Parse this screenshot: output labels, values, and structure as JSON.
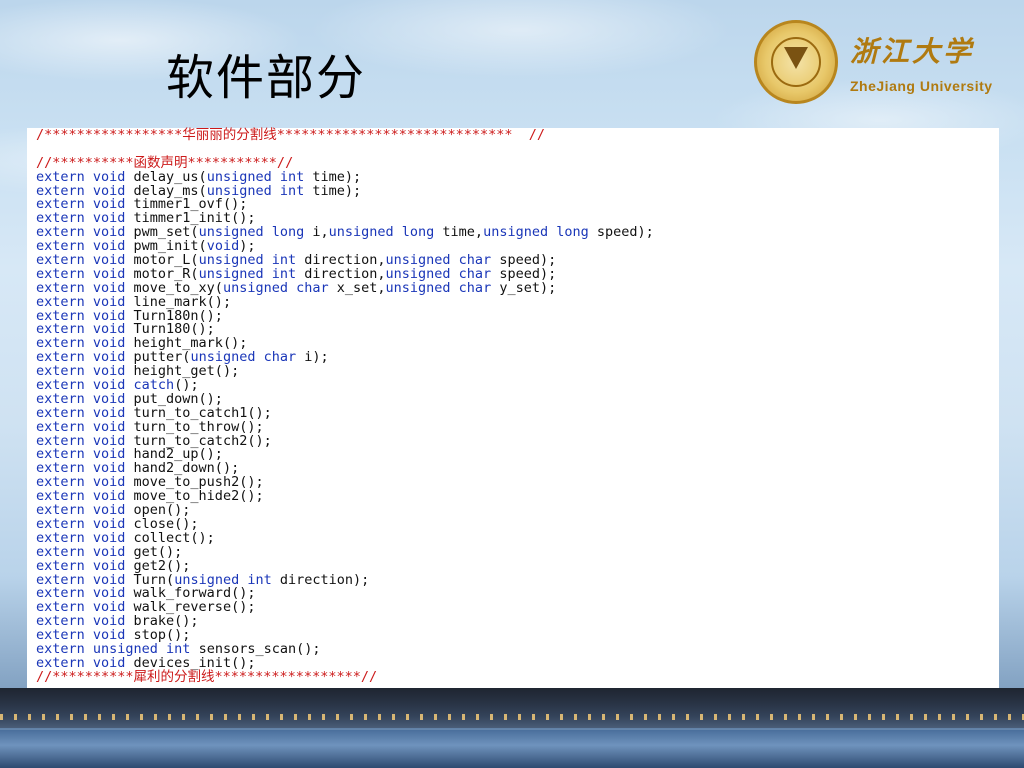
{
  "slide": {
    "title": "软件部分"
  },
  "logo": {
    "name_cn": "浙江大学",
    "name_en": "ZheJiang University"
  },
  "code_lines": [
    [
      [
        "/*****************华丽丽的分割线*****************************  //",
        "comment"
      ]
    ],
    [
      [
        "",
        "plain"
      ]
    ],
    [
      [
        "//**********函数声明***********//",
        "comment"
      ]
    ],
    [
      [
        "extern void",
        "kw"
      ],
      [
        " delay_us(",
        "plain"
      ],
      [
        "unsigned int",
        "kw"
      ],
      [
        " time);",
        "plain"
      ]
    ],
    [
      [
        "extern void",
        "kw"
      ],
      [
        " delay_ms(",
        "plain"
      ],
      [
        "unsigned int",
        "kw"
      ],
      [
        " time);",
        "plain"
      ]
    ],
    [
      [
        "extern void",
        "kw"
      ],
      [
        " timmer1_ovf();",
        "plain"
      ]
    ],
    [
      [
        "extern void",
        "kw"
      ],
      [
        " timmer1_init();",
        "plain"
      ]
    ],
    [
      [
        "extern void",
        "kw"
      ],
      [
        " pwm_set(",
        "plain"
      ],
      [
        "unsigned long",
        "kw"
      ],
      [
        " i,",
        "plain"
      ],
      [
        "unsigned long",
        "kw"
      ],
      [
        " time,",
        "plain"
      ],
      [
        "unsigned long",
        "kw"
      ],
      [
        " speed);",
        "plain"
      ]
    ],
    [
      [
        "extern void",
        "kw"
      ],
      [
        " pwm_init(",
        "plain"
      ],
      [
        "void",
        "kw"
      ],
      [
        ");",
        "plain"
      ]
    ],
    [
      [
        "extern void",
        "kw"
      ],
      [
        " motor_L(",
        "plain"
      ],
      [
        "unsigned int",
        "kw"
      ],
      [
        " direction,",
        "plain"
      ],
      [
        "unsigned char",
        "kw"
      ],
      [
        " speed);",
        "plain"
      ]
    ],
    [
      [
        "extern void",
        "kw"
      ],
      [
        " motor_R(",
        "plain"
      ],
      [
        "unsigned int",
        "kw"
      ],
      [
        " direction,",
        "plain"
      ],
      [
        "unsigned char",
        "kw"
      ],
      [
        " speed);",
        "plain"
      ]
    ],
    [
      [
        "extern void",
        "kw"
      ],
      [
        " move_to_xy(",
        "plain"
      ],
      [
        "unsigned char",
        "kw"
      ],
      [
        " x_set,",
        "plain"
      ],
      [
        "unsigned char",
        "kw"
      ],
      [
        " y_set);",
        "plain"
      ]
    ],
    [
      [
        "extern void",
        "kw"
      ],
      [
        " line_mark();",
        "plain"
      ]
    ],
    [
      [
        "extern void",
        "kw"
      ],
      [
        " Turn180n();",
        "plain"
      ]
    ],
    [
      [
        "extern void",
        "kw"
      ],
      [
        " Turn180();",
        "plain"
      ]
    ],
    [
      [
        "extern void",
        "kw"
      ],
      [
        " height_mark();",
        "plain"
      ]
    ],
    [
      [
        "extern void",
        "kw"
      ],
      [
        " putter(",
        "plain"
      ],
      [
        "unsigned char",
        "kw"
      ],
      [
        " i);",
        "plain"
      ]
    ],
    [
      [
        "extern void",
        "kw"
      ],
      [
        " height_get();",
        "plain"
      ]
    ],
    [
      [
        "extern void",
        "kw"
      ],
      [
        " ",
        "plain"
      ],
      [
        "catch",
        "kw"
      ],
      [
        "();",
        "plain"
      ]
    ],
    [
      [
        "extern void",
        "kw"
      ],
      [
        " put_down();",
        "plain"
      ]
    ],
    [
      [
        "extern void",
        "kw"
      ],
      [
        " turn_to_catch1();",
        "plain"
      ]
    ],
    [
      [
        "extern void",
        "kw"
      ],
      [
        " turn_to_throw();",
        "plain"
      ]
    ],
    [
      [
        "extern void",
        "kw"
      ],
      [
        " turn_to_catch2();",
        "plain"
      ]
    ],
    [
      [
        "extern void",
        "kw"
      ],
      [
        " hand2_up();",
        "plain"
      ]
    ],
    [
      [
        "extern void",
        "kw"
      ],
      [
        " hand2_down();",
        "plain"
      ]
    ],
    [
      [
        "extern void",
        "kw"
      ],
      [
        " move_to_push2();",
        "plain"
      ]
    ],
    [
      [
        "extern void",
        "kw"
      ],
      [
        " move_to_hide2();",
        "plain"
      ]
    ],
    [
      [
        "extern void",
        "kw"
      ],
      [
        " open();",
        "plain"
      ]
    ],
    [
      [
        "extern void",
        "kw"
      ],
      [
        " close();",
        "plain"
      ]
    ],
    [
      [
        "extern void",
        "kw"
      ],
      [
        " collect();",
        "plain"
      ]
    ],
    [
      [
        "extern void",
        "kw"
      ],
      [
        " get();",
        "plain"
      ]
    ],
    [
      [
        "extern void",
        "kw"
      ],
      [
        " get2();",
        "plain"
      ]
    ],
    [
      [
        "extern void",
        "kw"
      ],
      [
        " Turn(",
        "plain"
      ],
      [
        "unsigned int",
        "kw"
      ],
      [
        " direction);",
        "plain"
      ]
    ],
    [
      [
        "extern void",
        "kw"
      ],
      [
        " walk_forward();",
        "plain"
      ]
    ],
    [
      [
        "extern void",
        "kw"
      ],
      [
        " walk_reverse();",
        "plain"
      ]
    ],
    [
      [
        "extern void",
        "kw"
      ],
      [
        " brake();",
        "plain"
      ]
    ],
    [
      [
        "extern void",
        "kw"
      ],
      [
        " stop();",
        "plain"
      ]
    ],
    [
      [
        "extern unsigned int",
        "kw"
      ],
      [
        " sensors_scan();",
        "plain"
      ]
    ],
    [
      [
        "extern void",
        "kw"
      ],
      [
        " devices_init();",
        "plain"
      ]
    ],
    [
      [
        "//**********犀利的分割线******************//",
        "comment"
      ]
    ]
  ],
  "colors": {
    "comment": "#cc1a1a",
    "keyword": "#1a36b8",
    "text": "#111111",
    "logo_gold": "#b07a10"
  }
}
